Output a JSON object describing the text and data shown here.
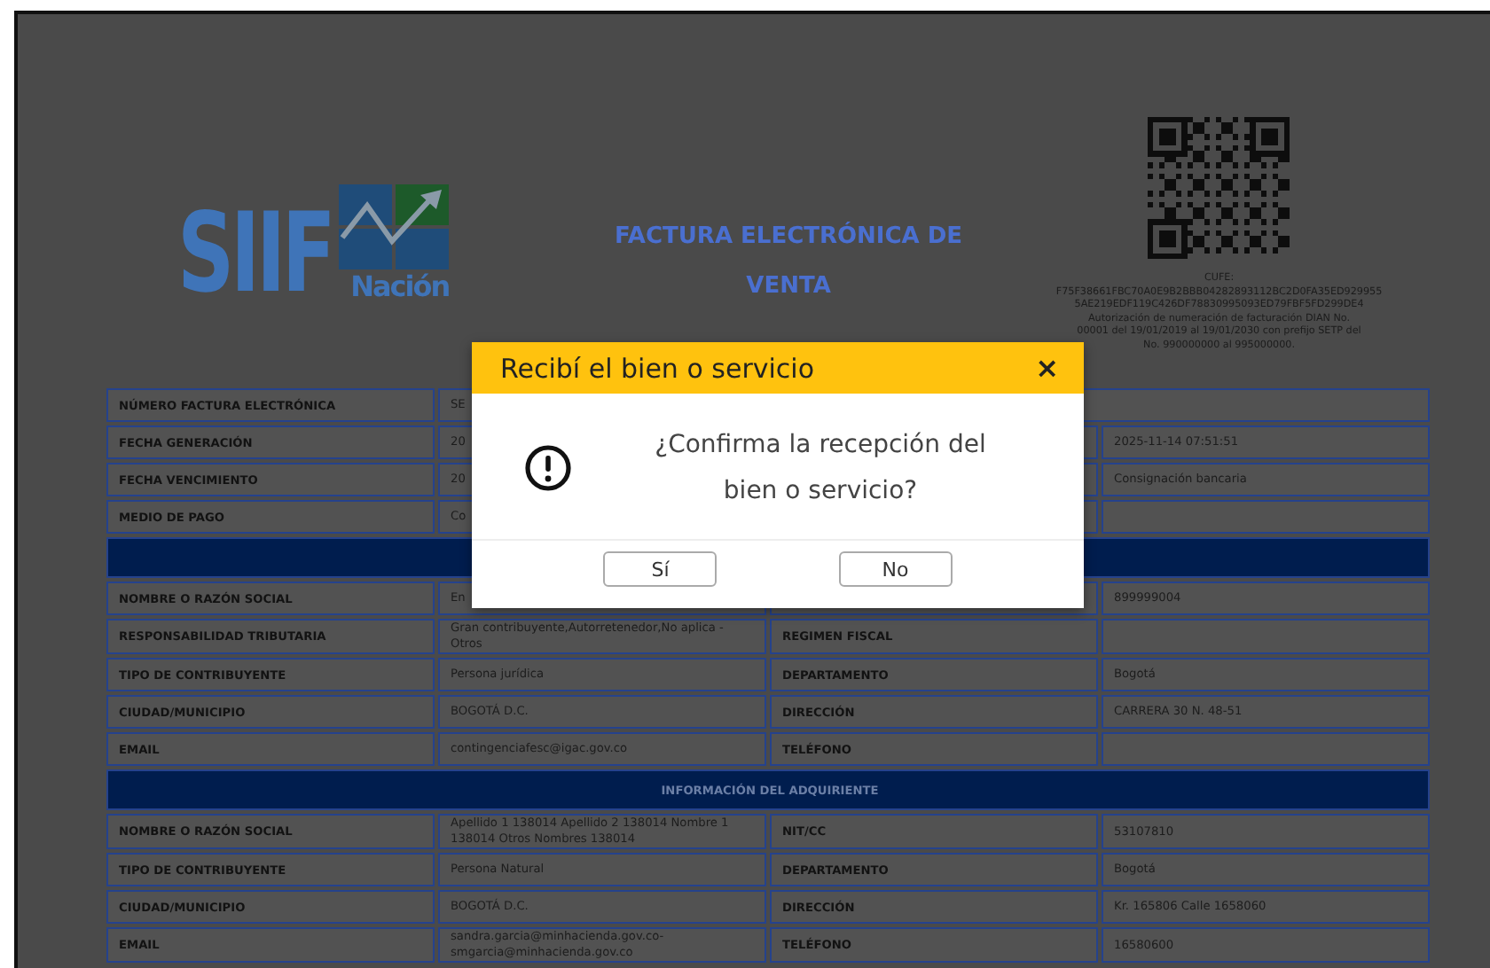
{
  "header": {
    "logo": {
      "main": "SIIF",
      "sub": "Nación"
    },
    "title": "FACTURA ELECTRÓNICA DE VENTA",
    "cufe_lines": [
      "CUFE:",
      "F75F38661FBC70A0E9B2BBB04282893112BC2D0FA35ED929955",
      "5AE219EDF119C426DF78830995093ED79FBF5FD299DE4",
      "Autorización de numeración de facturación DIAN No.",
      "00001 del 19/01/2019 al 19/01/2030 con prefijo SETP del",
      "No. 990000000 al 995000000."
    ]
  },
  "rows": [
    {
      "cells": [
        "NÚMERO FACTURA ELECTRÓNICA",
        "SE"
      ]
    },
    {
      "cells": [
        "FECHA GENERACIÓN",
        "20",
        null,
        "2025-11-14 07:51:51"
      ]
    },
    {
      "cells": [
        "FECHA VENCIMIENTO",
        "20",
        null,
        "Consignación bancaria"
      ]
    },
    {
      "cells": [
        "MEDIO DE PAGO",
        "Co",
        null,
        null
      ]
    },
    {
      "kind": "section"
    },
    {
      "cells": [
        "NOMBRE O RAZÓN SOCIAL",
        "En",
        null,
        "899999004"
      ]
    },
    {
      "cells": [
        "RESPONSABILIDAD TRIBUTARIA",
        "Gran contribuyente,Autorretenedor,No aplica - Otros",
        "REGIMEN FISCAL",
        null
      ]
    },
    {
      "cells": [
        "TIPO DE CONTRIBUYENTE",
        "Persona jurídica",
        "DEPARTAMENTO",
        "Bogotá"
      ]
    },
    {
      "cells": [
        "CIUDAD/MUNICIPIO",
        "BOGOTÁ D.C.",
        "DIRECCIÓN",
        "CARRERA 30 N. 48-51"
      ]
    },
    {
      "cells": [
        "EMAIL",
        "contingenciafesc@igac.gov.co",
        "TELÉFONO",
        null
      ]
    },
    {
      "kind": "section",
      "title": "INFORMACIÓN DEL ADQUIRIENTE"
    },
    {
      "cells": [
        "NOMBRE O RAZÓN SOCIAL",
        "Apellido 1 138014 Apellido 2 138014 Nombre 1 138014 Otros Nombres 138014",
        "NIT/CC",
        "53107810"
      ]
    },
    {
      "cells": [
        "TIPO DE CONTRIBUYENTE",
        "Persona Natural",
        "DEPARTAMENTO",
        "Bogotá"
      ]
    },
    {
      "cells": [
        "CIUDAD/MUNICIPIO",
        "BOGOTÁ D.C.",
        "DIRECCIÓN",
        "Kr. 165806 Calle 1658060"
      ]
    },
    {
      "cells": [
        "EMAIL",
        "sandra.garcia@minhacienda.gov.co-smgarcia@minhacienda.gov.co",
        "TELÉFONO",
        "16580600"
      ]
    }
  ],
  "dialog": {
    "title": "Recibí el bien o servicio",
    "close": "×",
    "message": "¿Confirma la recepción del bien o servicio?",
    "buttons": [
      "Sí",
      "No"
    ]
  }
}
